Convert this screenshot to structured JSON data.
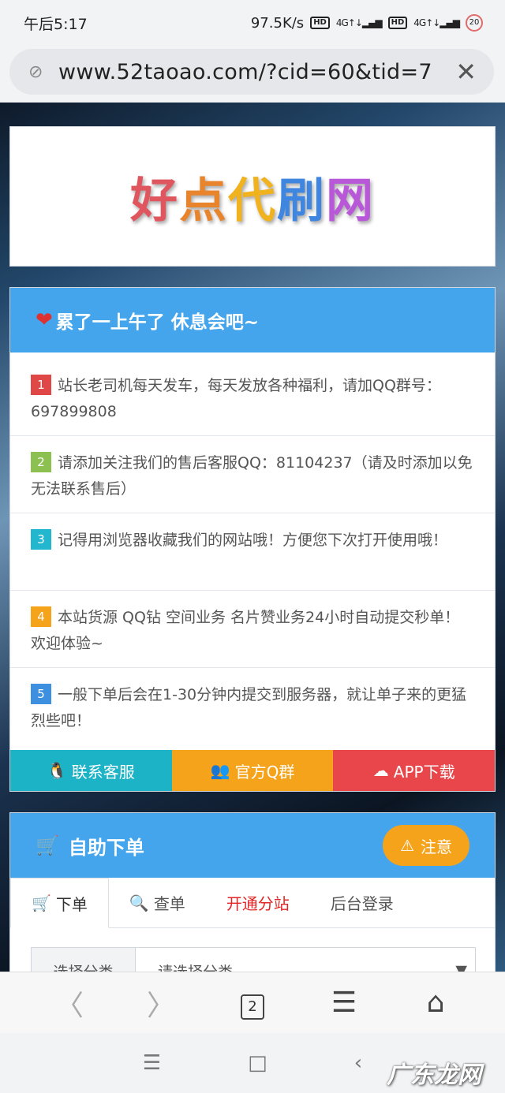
{
  "status": {
    "time": "午后5:17",
    "speed": "97.5K/s",
    "battery": "20"
  },
  "browser": {
    "url": "www.52taoao.com/?cid=60&tid=7"
  },
  "logo": [
    "好",
    "点",
    "代",
    "刷",
    "网"
  ],
  "notice": {
    "heading": "累了一上午了 休息会吧~",
    "items": [
      {
        "num": "1",
        "text": "站长老司机每天发车，每天发放各种福利，请加QQ群号：697899808"
      },
      {
        "num": "2",
        "text": "请添加关注我们的售后客服QQ：81104237（请及时添加以免无法联系售后）"
      },
      {
        "num": "3",
        "text": "记得用浏览器收藏我们的网站哦！方便您下次打开使用哦！"
      },
      {
        "num": "4",
        "text": "本站货源 QQ钻 空间业务 名片赞业务24小时自动提交秒单！欢迎体验~"
      },
      {
        "num": "5",
        "text": "一般下单后会在1-30分钟内提交到服务器，就让单子来的更猛烈些吧！"
      }
    ],
    "buttons": [
      "联系客服",
      "官方Q群",
      "APP下载"
    ]
  },
  "order": {
    "title": "自助下单",
    "note_button": "注意",
    "tabs": [
      "下单",
      "查单",
      "开通分站",
      "后台登录"
    ],
    "select_label": "选择分类",
    "select_value": "请选择分类"
  },
  "nav": {
    "tab_count": "2"
  },
  "watermark": "广东龙网"
}
